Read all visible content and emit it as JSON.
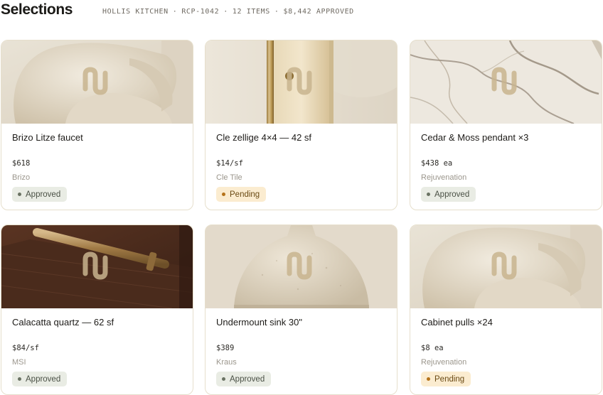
{
  "header": {
    "title": "Selections",
    "project": "HOLLIS KITCHEN",
    "code": "RCP-1042",
    "items_count": "12 ITEMS",
    "approved_total": "$8,442 APPROVED",
    "separator": "·"
  },
  "cards": [
    {
      "name": "Brizo Litze faucet",
      "price": "$618",
      "vendor": "Brizo",
      "status": "Approved",
      "image": "armchair"
    },
    {
      "name": "Cle zellige 4×4 — 42 sf",
      "price": "$14/sf",
      "vendor": "Cle Tile",
      "status": "Pending",
      "image": "brass-sconce"
    },
    {
      "name": "Cedar & Moss pendant ×3",
      "price": "$438 ea",
      "vendor": "Rejuvenation",
      "status": "Approved",
      "image": "marble-slab"
    },
    {
      "name": "Calacatta quartz — 62 sf",
      "price": "$84/sf",
      "vendor": "MSI",
      "status": "Approved",
      "image": "walnut-pull"
    },
    {
      "name": "Undermount sink 30\"",
      "price": "$389",
      "vendor": "Kraus",
      "status": "Approved",
      "image": "ceramic-vase"
    },
    {
      "name": "Cabinet pulls ×24",
      "price": "$8 ea",
      "vendor": "Rejuvenation",
      "status": "Pending",
      "image": "armchair"
    }
  ],
  "colors": {
    "card_border": "#e6dfcc",
    "approved_bg": "#e9ece4",
    "pending_bg": "#fbecd0",
    "logo_mark": "#c8b48e"
  }
}
